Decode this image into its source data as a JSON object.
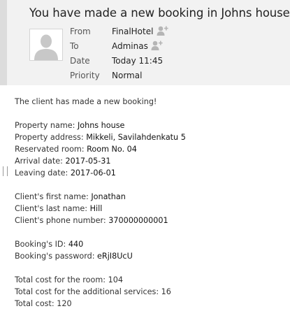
{
  "subject": "You have made a new booking in Johns house",
  "meta": [
    {
      "label": "From",
      "value": "FinalHotel",
      "add_contact": true
    },
    {
      "label": "To",
      "value": "Adminas",
      "add_contact": true
    },
    {
      "label": "Date",
      "value": "Today 11:45",
      "add_contact": false
    },
    {
      "label": "Priority",
      "value": "Normal",
      "add_contact": false
    }
  ],
  "icons": {
    "avatar": "user-silhouette-icon",
    "add_contact": "add-contact-icon"
  },
  "body": {
    "intro": "The client has made a new booking!",
    "property_name": {
      "label": "Property name: ",
      "value": "Johns house"
    },
    "property_address": {
      "label": "Property address: ",
      "value": "Mikkeli, Savilahdenkatu 5"
    },
    "room": {
      "label": "Reservated room: ",
      "value": "Room No. 04"
    },
    "arrival": {
      "label": "Arrival date: ",
      "value": "2017-05-31"
    },
    "leaving": {
      "label": "Leaving date: ",
      "value": "2017-06-01"
    },
    "first_name": {
      "label": "Client's first name: ",
      "value": "Jonathan"
    },
    "last_name": {
      "label": "Client's last name: ",
      "value": "Hill"
    },
    "phone": {
      "label": "Client's phone number: ",
      "value": "370000000001"
    },
    "booking_id": {
      "label": "Booking's ID: ",
      "value": "440"
    },
    "booking_password": {
      "label": "Booking's password: ",
      "value": "eRjI8UcU"
    },
    "room_cost": {
      "label": "Total cost for the room: ",
      "value": "104"
    },
    "services_cost": {
      "label": "Total cost for the additional services: ",
      "value": "16"
    },
    "total_cost": {
      "label": "Total cost: ",
      "value": "120"
    }
  }
}
